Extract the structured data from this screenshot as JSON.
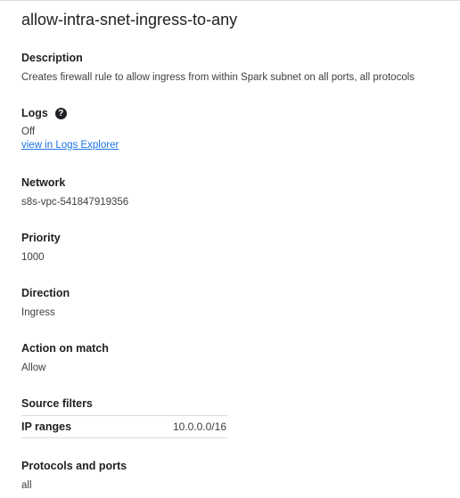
{
  "title": "allow-intra-snet-ingress-to-any",
  "description": {
    "label": "Description",
    "value": "Creates firewall rule to allow ingress from within Spark subnet on all ports, all protocols"
  },
  "logs": {
    "label": "Logs",
    "help_icon": "help-circle-icon",
    "help_glyph": "?",
    "value": "Off",
    "link": "view in Logs Explorer"
  },
  "network": {
    "label": "Network",
    "value": "s8s-vpc-541847919356"
  },
  "priority": {
    "label": "Priority",
    "value": "1000"
  },
  "direction": {
    "label": "Direction",
    "value": "Ingress"
  },
  "action": {
    "label": "Action on match",
    "value": "Allow"
  },
  "source_filters": {
    "label": "Source filters",
    "rows": [
      {
        "key": "IP ranges",
        "value": "10.0.0.0/16"
      }
    ]
  },
  "protocols": {
    "label": "Protocols and ports",
    "value": "all"
  }
}
